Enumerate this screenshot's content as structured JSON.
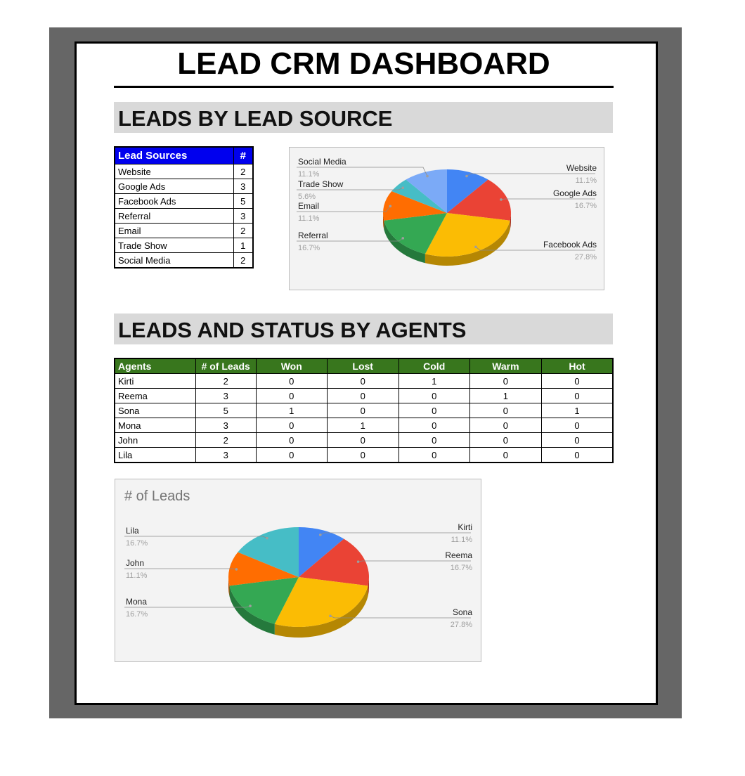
{
  "title": "LEAD CRM DASHBOARD",
  "sections": {
    "lead_source": "LEADS BY LEAD SOURCE",
    "agents": "LEADS AND STATUS BY AGENTS"
  },
  "source_table": {
    "headers": [
      "Lead Sources",
      "#"
    ],
    "rows": [
      [
        "Website",
        "2"
      ],
      [
        "Google Ads",
        "3"
      ],
      [
        "Facebook Ads",
        "5"
      ],
      [
        "Referral",
        "3"
      ],
      [
        "Email",
        "2"
      ],
      [
        "Trade Show",
        "1"
      ],
      [
        "Social Media",
        "2"
      ]
    ]
  },
  "agent_table": {
    "headers": [
      "Agents",
      "# of Leads",
      "Won",
      "Lost",
      "Cold",
      "Warm",
      "Hot"
    ],
    "rows": [
      [
        "Kirti",
        "2",
        "0",
        "0",
        "1",
        "0",
        "0"
      ],
      [
        "Reema",
        "3",
        "0",
        "0",
        "0",
        "1",
        "0"
      ],
      [
        "Sona",
        "5",
        "1",
        "0",
        "0",
        "0",
        "1"
      ],
      [
        "Mona",
        "3",
        "0",
        "1",
        "0",
        "0",
        "0"
      ],
      [
        "John",
        "2",
        "0",
        "0",
        "0",
        "0",
        "0"
      ],
      [
        "Lila",
        "3",
        "0",
        "0",
        "0",
        "0",
        "0"
      ]
    ]
  },
  "chart_data": [
    {
      "type": "pie",
      "title": "",
      "categories": [
        "Website",
        "Google Ads",
        "Facebook Ads",
        "Referral",
        "Email",
        "Trade Show",
        "Social Media"
      ],
      "values": [
        2,
        3,
        5,
        3,
        2,
        1,
        2
      ],
      "percent_labels": [
        "11.1%",
        "16.7%",
        "27.8%",
        "16.7%",
        "11.1%",
        "5.6%",
        "11.1%"
      ],
      "colors": [
        "#4285f4",
        "#ea4335",
        "#fbbc04",
        "#34a853",
        "#ff6d01",
        "#46bdc6",
        "#7baaf7"
      ],
      "legend": "labeled",
      "style": "3d"
    },
    {
      "type": "pie",
      "title": "# of Leads",
      "categories": [
        "Kirti",
        "Reema",
        "Sona",
        "Mona",
        "John",
        "Lila"
      ],
      "values": [
        2,
        3,
        5,
        3,
        2,
        3
      ],
      "percent_labels": [
        "11.1%",
        "16.7%",
        "27.8%",
        "16.7%",
        "11.1%",
        "16.7%"
      ],
      "colors": [
        "#4285f4",
        "#ea4335",
        "#fbbc04",
        "#34a853",
        "#ff6d01",
        "#46bdc6"
      ],
      "legend": "labeled",
      "style": "3d"
    }
  ]
}
